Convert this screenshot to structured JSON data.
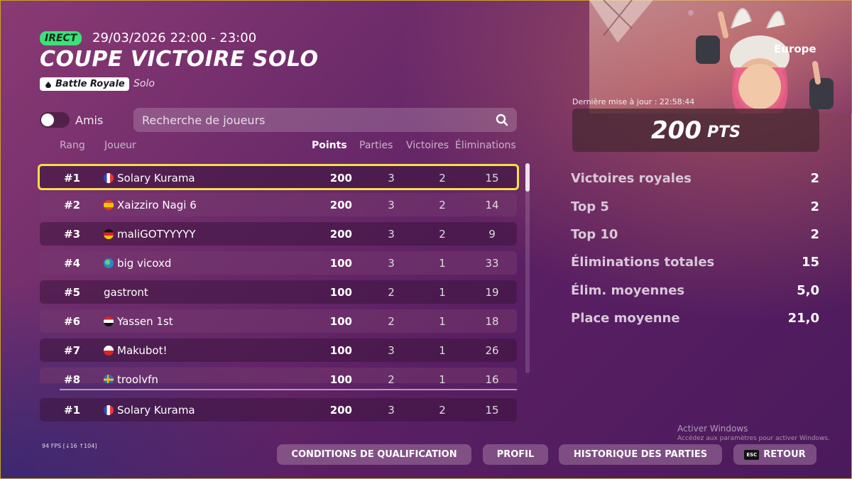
{
  "header": {
    "live_badge": "IRECT",
    "datetime": "29/03/2026 22:00 - 23:00",
    "title": "COUPE VICTOIRE SOLO",
    "mode": "Battle Royale",
    "mode_sub": "Solo"
  },
  "filters": {
    "friends_label": "Amis",
    "friends_toggle": false,
    "search_placeholder": "Recherche de joueurs"
  },
  "table": {
    "columns": [
      "Rang",
      "Joueur",
      "Points",
      "Parties",
      "Victoires",
      "Éliminations"
    ],
    "rows": [
      {
        "rank": "#1",
        "flag": "fr",
        "player": "Solary Kurama",
        "points": "200",
        "games": "3",
        "wins": "2",
        "elims": "15"
      },
      {
        "rank": "#2",
        "flag": "es",
        "player": "Xaizziro Nagi 6",
        "points": "200",
        "games": "3",
        "wins": "2",
        "elims": "14"
      },
      {
        "rank": "#3",
        "flag": "de",
        "player": "maliGOTYYYYY",
        "points": "200",
        "games": "3",
        "wins": "2",
        "elims": "9"
      },
      {
        "rank": "#4",
        "flag": "globe",
        "player": "big vicoxd",
        "points": "100",
        "games": "3",
        "wins": "1",
        "elims": "33"
      },
      {
        "rank": "#5",
        "flag": "",
        "player": "gastront",
        "points": "100",
        "games": "2",
        "wins": "1",
        "elims": "19"
      },
      {
        "rank": "#6",
        "flag": "eg",
        "player": "Yassen 1st",
        "points": "100",
        "games": "2",
        "wins": "1",
        "elims": "18"
      },
      {
        "rank": "#7",
        "flag": "pl",
        "player": "Makubot!",
        "points": "100",
        "games": "3",
        "wins": "1",
        "elims": "26"
      },
      {
        "rank": "#8",
        "flag": "se",
        "player": "troolyfn",
        "points": "100",
        "games": "2",
        "wins": "1",
        "elims": "16"
      }
    ],
    "self_row": {
      "rank": "#1",
      "flag": "fr",
      "player": "Solary Kurama",
      "points": "200",
      "games": "3",
      "wins": "2",
      "elims": "15"
    }
  },
  "panel": {
    "region": "Europe",
    "updated": "Dernière mise à jour : 22:58:44",
    "points": "200",
    "points_unit": "PTS",
    "stats": [
      {
        "label": "Victoires royales",
        "value": "2"
      },
      {
        "label": "Top 5",
        "value": "2"
      },
      {
        "label": "Top 10",
        "value": "2"
      },
      {
        "label": "Éliminations totales",
        "value": "15"
      },
      {
        "label": "Élim. moyennes",
        "value": "5,0"
      },
      {
        "label": "Place moyenne",
        "value": "21,0"
      }
    ]
  },
  "footer": {
    "fps": "94 FPS [↓16 ↑104]",
    "buttons": {
      "qualification": "CONDITIONS DE QUALIFICATION",
      "profile": "PROFIL",
      "history": "HISTORIQUE DES PARTIES",
      "back": "RETOUR",
      "back_key": "ESC"
    }
  },
  "windows_watermark": {
    "title": "Activer Windows",
    "subtitle": "Accédez aux paramètres pour activer Windows."
  }
}
